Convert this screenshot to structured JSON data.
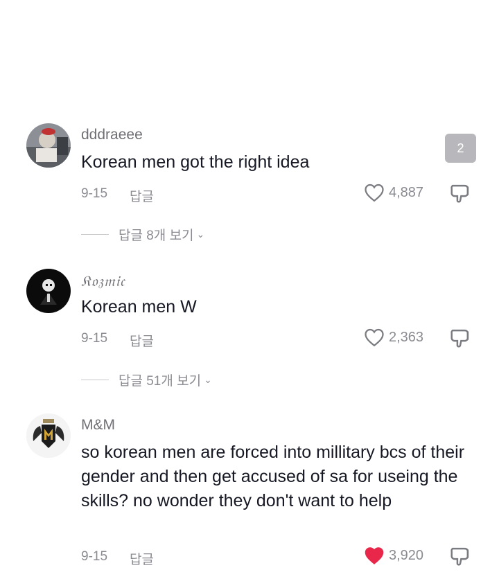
{
  "badge_count": "2",
  "comments": [
    {
      "username": "dddraeee",
      "text": "Korean men got the right idea",
      "date": "9-15",
      "reply_label": "답글",
      "likes": "4,887",
      "liked": false,
      "view_replies": "답글 8개 보기",
      "avatar_icon": "user-avatar-photo"
    },
    {
      "username": "𝔎𝔬𝔷𝔪𝔦𝔠",
      "text": "Korean men W",
      "date": "9-15",
      "reply_label": "답글",
      "likes": "2,363",
      "liked": false,
      "view_replies": "답글 51개 보기",
      "avatar_icon": "skull-suit-avatar"
    },
    {
      "username": "M&M",
      "text": "so korean men are forced into millitary bcs of their gender and then get accused of sa for useing the skills? no wonder they don't want to help",
      "date": "9-15",
      "reply_label": "답글",
      "likes": "3,920",
      "liked": true,
      "avatar_icon": "emblem-avatar"
    }
  ],
  "colors": {
    "liked_heart": "#e8274a",
    "muted": "#8a8b91"
  }
}
